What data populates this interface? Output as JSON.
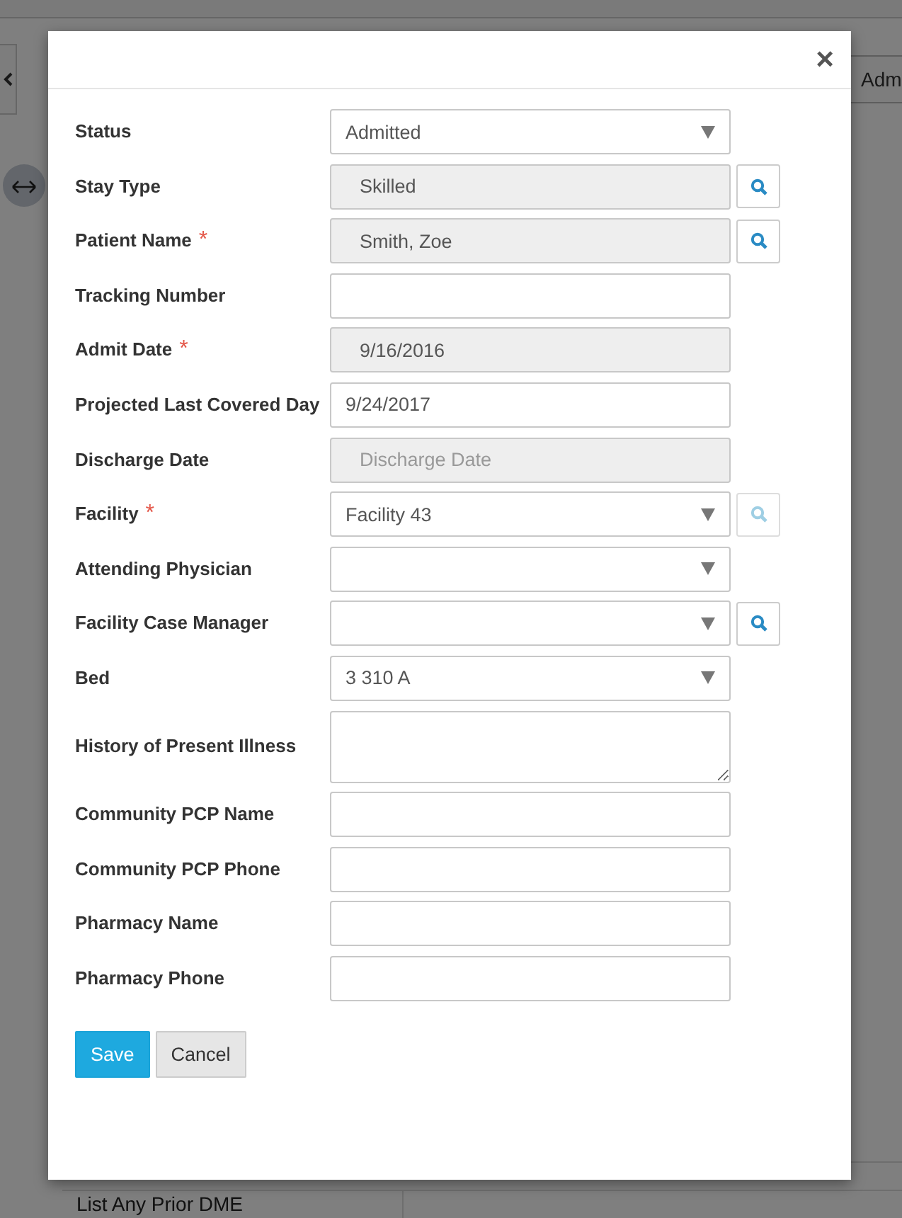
{
  "background": {
    "header_button": "Adm",
    "table_rows": [
      "List Any Prior DME"
    ]
  },
  "dialog": {
    "close": "×",
    "fields": [
      {
        "label": "Status",
        "kind": "select",
        "value": "Admitted"
      },
      {
        "label": "Stay Type",
        "kind": "readonly",
        "value": "Skilled",
        "search": {
          "disabled": false
        }
      },
      {
        "label": "Patient Name",
        "kind": "readonly",
        "value": "Smith, Zoe",
        "required_mark": "*",
        "search": {
          "disabled": false
        }
      },
      {
        "label": "Tracking Number",
        "kind": "text"
      },
      {
        "label": "Admit Date",
        "kind": "readonly",
        "value": "9/16/2016",
        "required_mark": "*"
      },
      {
        "label": "Projected Last Covered Day",
        "kind": "text",
        "value": "9/24/2017"
      },
      {
        "label": "Discharge Date",
        "kind": "readonly",
        "placeholder": "Discharge Date"
      },
      {
        "label": "Facility",
        "kind": "select",
        "value": "Facility 43",
        "required_mark": "*",
        "search": {
          "disabled": true
        }
      },
      {
        "label": "Attending Physician",
        "kind": "select"
      },
      {
        "label": "Facility Case Manager",
        "kind": "select",
        "search": {
          "disabled": false
        }
      },
      {
        "label": "Bed",
        "kind": "select",
        "value": "3 310 A"
      },
      {
        "label": "History of Present Illness",
        "kind": "textarea"
      },
      {
        "label": "Community PCP Name",
        "kind": "text"
      },
      {
        "label": "Community PCP Phone",
        "kind": "text"
      },
      {
        "label": "Pharmacy Name",
        "kind": "text"
      },
      {
        "label": "Pharmacy Phone",
        "kind": "text"
      }
    ],
    "buttons": [
      {
        "label": "Save",
        "kind": "primary"
      },
      {
        "label": "Cancel",
        "kind": "secondary"
      }
    ]
  }
}
